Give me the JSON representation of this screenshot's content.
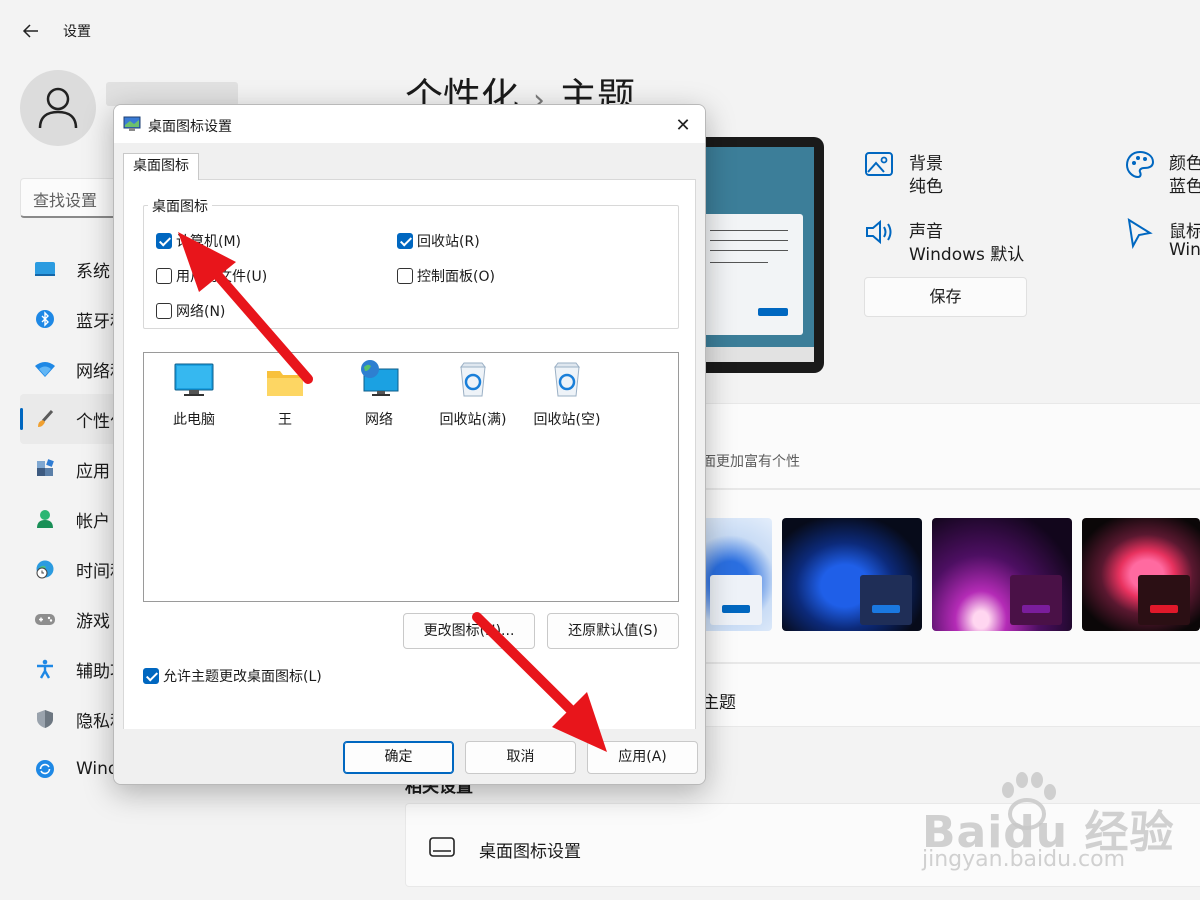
{
  "window": {
    "title": "设置"
  },
  "search": {
    "placeholder": "查找设置"
  },
  "nav": {
    "items": [
      {
        "label": "系统",
        "icon": "monitor-icon"
      },
      {
        "label": "蓝牙和",
        "icon": "bluetooth-icon"
      },
      {
        "label": "网络和",
        "icon": "wifi-icon"
      },
      {
        "label": "个性化",
        "icon": "brush-icon",
        "selected": true
      },
      {
        "label": "应用",
        "icon": "apps-icon"
      },
      {
        "label": "帐户",
        "icon": "account-icon"
      },
      {
        "label": "时间和",
        "icon": "globe-clock-icon"
      },
      {
        "label": "游戏",
        "icon": "gamepad-icon"
      },
      {
        "label": "辅助功",
        "icon": "accessibility-icon"
      },
      {
        "label": "隐私和",
        "icon": "shield-icon"
      },
      {
        "label": "Wind",
        "icon": "windows-update-icon"
      }
    ]
  },
  "page": {
    "breadcrumb_parent": "个性化",
    "breadcrumb_sep": "›",
    "breadcrumb_current": "主题"
  },
  "theme_props": {
    "background": {
      "name": "背景",
      "value": "纯色"
    },
    "color": {
      "name": "颜色",
      "value": "蓝色"
    },
    "sound": {
      "name": "声音",
      "value": "Windows 默认"
    },
    "cursor": {
      "name": "鼠标",
      "value": "Win"
    },
    "save_label": "保存"
  },
  "themes_card": {
    "desc_fragment": "面更加富有个性"
  },
  "more_themes_fragment": "主题",
  "related": {
    "title_fragment": "相关设置",
    "desktop_icons_link": "桌面图标设置"
  },
  "dialog": {
    "title": "桌面图标设置",
    "close_glyph": "✕",
    "tab": "桌面图标",
    "group_label": "桌面图标",
    "checkboxes": [
      {
        "label": "计算机(M)",
        "checked": true
      },
      {
        "label": "回收站(R)",
        "checked": true
      },
      {
        "label": "用户的文件(U)",
        "checked": false
      },
      {
        "label": "控制面板(O)",
        "checked": false
      },
      {
        "label": "网络(N)",
        "checked": false
      }
    ],
    "icons": [
      {
        "label": "此电脑",
        "icon": "this-pc-icon"
      },
      {
        "label": "王",
        "icon": "user-folder-icon"
      },
      {
        "label": "网络",
        "icon": "network-icon"
      },
      {
        "label": "回收站(满)",
        "icon": "recycle-bin-full-icon"
      },
      {
        "label": "回收站(空)",
        "icon": "recycle-bin-empty-icon"
      }
    ],
    "change_icon_label": "更改图标(H)...",
    "restore_default_label": "还原默认值(S)",
    "allow_themes_label": "允许主题更改桌面图标(L)",
    "allow_themes_checked": true,
    "ok_label": "确定",
    "cancel_label": "取消",
    "apply_label": "应用(A)"
  },
  "watermark": {
    "brand": "Baidu 经验",
    "url": "jingyan.baidu.com"
  },
  "colors": {
    "accent": "#0067c0",
    "annotation_arrow": "#e8151b"
  }
}
